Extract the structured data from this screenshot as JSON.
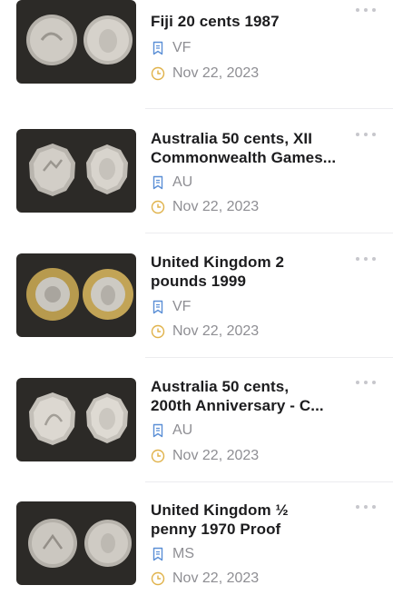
{
  "items": [
    {
      "title_lines": [
        "Fiji 20 cents 1987"
      ],
      "grade": "VF",
      "date": "Nov 22, 2023",
      "coin_style": "silver"
    },
    {
      "title_lines": [
        "Australia 50 cents, XII",
        "Commonwealth Games..."
      ],
      "grade": "AU",
      "date": "Nov 22, 2023",
      "coin_style": "silver"
    },
    {
      "title_lines": [
        "United Kingdom 2",
        "pounds 1999"
      ],
      "grade": "VF",
      "date": "Nov 22, 2023",
      "coin_style": "bimetal"
    },
    {
      "title_lines": [
        "Australia 50 cents,",
        "200th Anniversary - C..."
      ],
      "grade": "AU",
      "date": "Nov 22, 2023",
      "coin_style": "silver"
    },
    {
      "title_lines": [
        "United Kingdom ½",
        "penny 1970 Proof"
      ],
      "grade": "MS",
      "date": "Nov 22, 2023",
      "coin_style": "silver"
    }
  ],
  "icons": {
    "grade": "grade-bookmark-icon",
    "date": "clock-icon",
    "more": "more-options-icon"
  },
  "colors": {
    "grade_icon": "#5b8fd6",
    "date_icon": "#e0b24a",
    "meta_text": "#8e8e93",
    "thumb_bg": "#2c2a27"
  }
}
